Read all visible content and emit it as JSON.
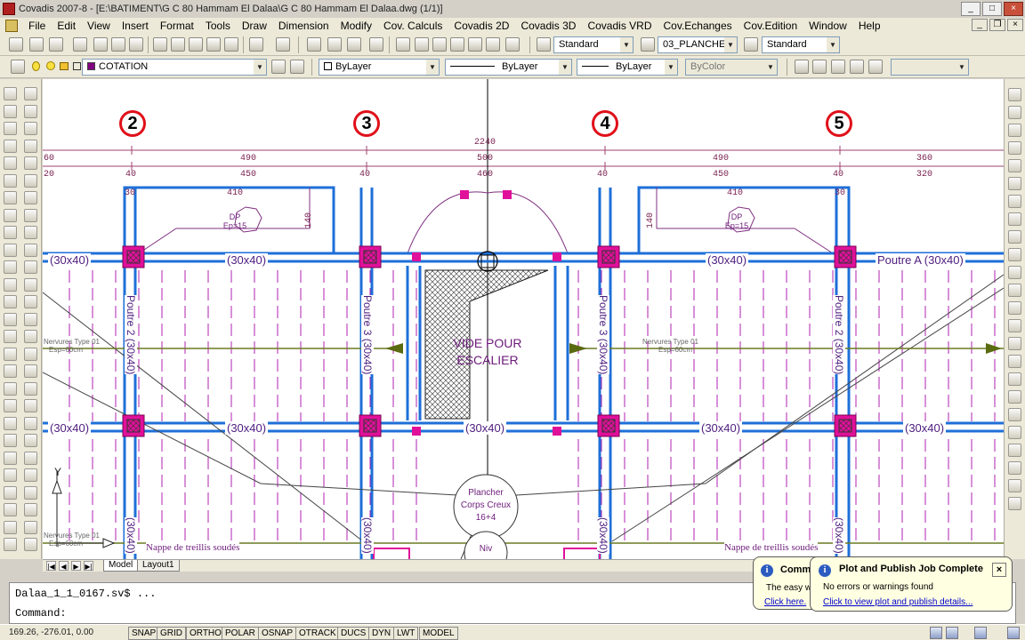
{
  "window": {
    "title": "Covadis 2007-8 - [E:\\BATIMENT\\G C 80 Hammam El Dalaa\\G C 80 Hammam El Dalaa.dwg (1/1)]"
  },
  "menu": [
    "File",
    "Edit",
    "View",
    "Insert",
    "Format",
    "Tools",
    "Draw",
    "Dimension",
    "Modify",
    "Cov. Calculs",
    "Covadis 2D",
    "Covadis 3D",
    "Covadis VRD",
    "Cov.Echanges",
    "Cov.Edition",
    "Window",
    "Help"
  ],
  "toolbar1": {
    "text_style": "Standard",
    "layer_state": "03_PLANCHE",
    "dim_style": "Standard"
  },
  "toolbar2": {
    "current_layer": "COTATION",
    "color": "ByLayer",
    "linetype": "ByLayer",
    "lineweight": "ByLayer",
    "plotstyle": "ByColor",
    "layer_color": "#800080"
  },
  "drawing": {
    "axes": [
      "2",
      "3",
      "4",
      "5"
    ],
    "dims_total": "2240",
    "dims_row1": [
      "60",
      "490",
      "500",
      "490",
      "360"
    ],
    "dims_row2": [
      "20",
      "40",
      "450",
      "40",
      "460",
      "40",
      "450",
      "40",
      "320"
    ],
    "dims_row3": [
      "30",
      "410",
      "140",
      "410",
      "140",
      "30"
    ],
    "beam_row_a": [
      "(30x40)",
      "(30x40)",
      "(30x40)",
      "Poutre A  (30x40)"
    ],
    "beam_row_b": [
      "(30x40)",
      "(30x40)",
      "(30x40)",
      "(30x40)",
      "(30x40)"
    ],
    "beams_vertical": [
      "Poutre 2  (30x40)",
      "Poutre 3  (30x40)",
      "Poutre 3  (30x40)",
      "Poutre 2  (30x40)"
    ],
    "beam_stub": "(30x40)",
    "void_label": [
      "VIDE POUR",
      "ESCALIER"
    ],
    "dp_label": [
      "DP",
      "Ep=15"
    ],
    "nervures_left": [
      "Nervures Type 01",
      "Esp=60cm"
    ],
    "nervures_right": [
      "Nervures Type 01",
      "Esp=60cm"
    ],
    "nervures_bottom": [
      "Nervures Type 01",
      "Esp=60cm"
    ],
    "plancher": [
      "Plancher",
      "Corps Creux",
      "16+4"
    ],
    "niv": "Niv",
    "nappe": "Nappe de treillis soudés",
    "ucs_y": "Y"
  },
  "tabs": [
    "Model",
    "Layout1"
  ],
  "command": {
    "history": "Dalaa_1_1_0167.sv$ ...",
    "prompt": "Command:"
  },
  "status": {
    "coords": "169.26, -276.01, 0.00",
    "toggles": [
      "SNAP",
      "GRID",
      "ORTHO",
      "POLAR",
      "OSNAP",
      "OTRACK",
      "DUCS",
      "DYN",
      "LWT",
      "MODEL"
    ]
  },
  "balloon_back": {
    "title": "Commu",
    "text": "The easy wa",
    "link": "Click here."
  },
  "balloon": {
    "title": "Plot and Publish Job Complete",
    "text": "No errors or warnings found",
    "link": "Click to view plot and publish details..."
  },
  "colors": {
    "beam": "#1e6fd8",
    "column": "#e0109a",
    "accent": "#e0101a",
    "balloon_bg": "#ffffe1"
  }
}
